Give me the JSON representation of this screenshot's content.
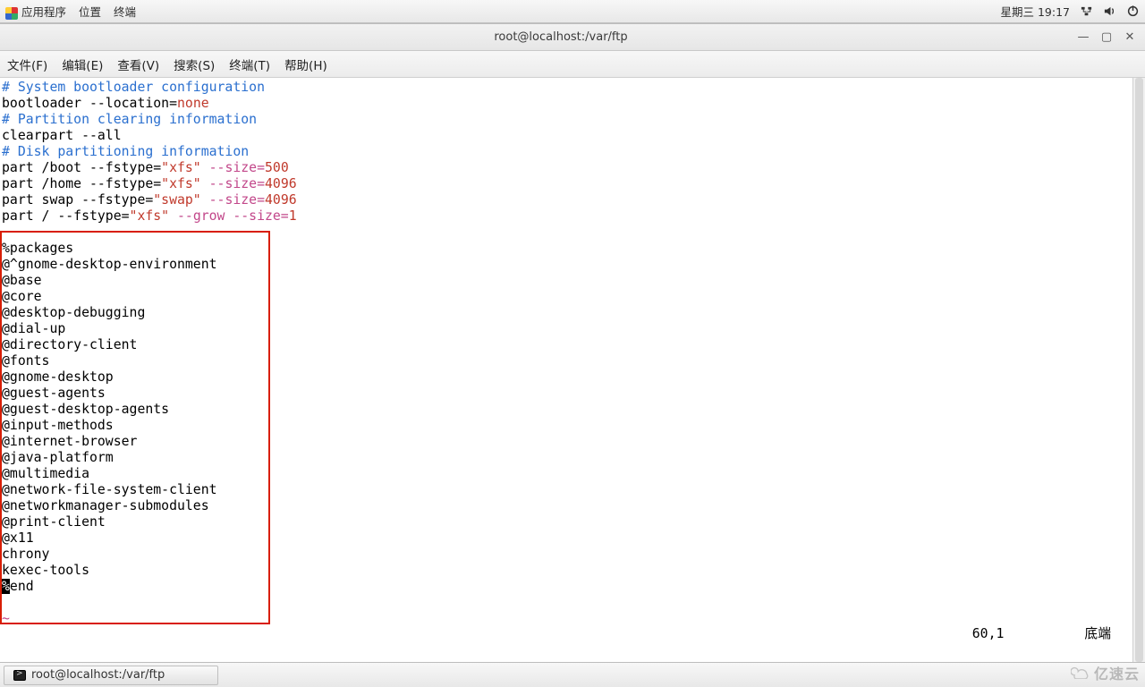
{
  "top_panel": {
    "apps": "应用程序",
    "places": "位置",
    "terminal": "终端",
    "clock": "星期三 19:17"
  },
  "window": {
    "title": "root@localhost:/var/ftp",
    "menus": {
      "file": "文件(F)",
      "edit": "编辑(E)",
      "view": "查看(V)",
      "search": "搜索(S)",
      "terminal": "终端(T)",
      "help": "帮助(H)"
    },
    "ctrl": {
      "min": "—",
      "max": "▢",
      "close": "✕"
    }
  },
  "content": {
    "c1": "# System bootloader configuration",
    "l2a": "bootloader --location=",
    "l2b": "none",
    "c3": "# Partition clearing information",
    "l4": "clearpart --all",
    "c5": "# Disk partitioning information",
    "l6a": "part /boot --fstype=",
    "l6b": "\"xfs\"",
    "l6c": " --size=",
    "l6d": "500",
    "l7a": "part /home --fstype=",
    "l7b": "\"xfs\"",
    "l7c": " --size=",
    "l7d": "4096",
    "l8a": "part swap --fstype=",
    "l8b": "\"swap\"",
    "l8c": " --size=",
    "l8d": "4096",
    "l9a": "part / --fstype=",
    "l9b": "\"xfs\"",
    "l9c": " --grow --size=",
    "l9d": "1",
    "pkg": {
      "pk": "%packages",
      "p1": "@^gnome-desktop-environment",
      "p2": "@base",
      "p3": "@core",
      "p4": "@desktop-debugging",
      "p5": "@dial-up",
      "p6": "@directory-client",
      "p7": "@fonts",
      "p8": "@gnome-desktop",
      "p9": "@guest-agents",
      "p10": "@guest-desktop-agents",
      "p11": "@input-methods",
      "p12": "@internet-browser",
      "p13": "@java-platform",
      "p14": "@multimedia",
      "p15": "@network-file-system-client",
      "p16": "@networkmanager-submodules",
      "p17": "@print-client",
      "p18": "@x11",
      "p19": "chrony",
      "p20": "kexec-tools",
      "end_cur": "%",
      "end_rest": "end",
      "tilde": "~"
    },
    "status_pos": "60,1",
    "status_mode": "底端"
  },
  "taskbar": {
    "item": "root@localhost:/var/ftp"
  },
  "watermark": "亿速云"
}
